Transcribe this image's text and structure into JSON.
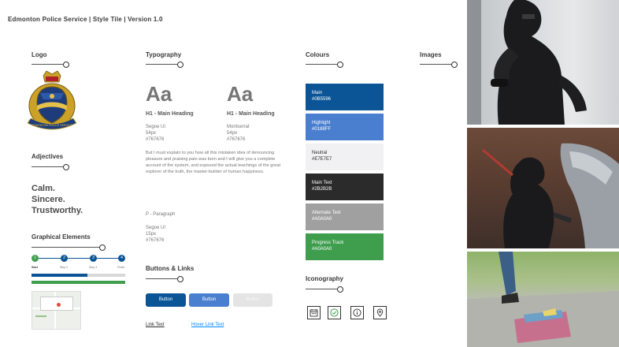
{
  "header": {
    "title": "Edmonton Police Service | Style Tile | Version 1.0"
  },
  "logo": {
    "heading": "Logo",
    "crest_text": "EDMONTON POLICE SERVICE"
  },
  "adjectives": {
    "heading": "Adjectives",
    "words": [
      "Calm.",
      "Sincere.",
      "Trustworthy."
    ]
  },
  "graphical": {
    "heading": "Graphical Elements",
    "steps": [
      "1",
      "2",
      "3",
      "4"
    ],
    "step_labels": [
      "Start",
      "Step 2",
      "Step 3",
      "Finish"
    ],
    "progress": 0.6,
    "progress_color": "#0B5596",
    "track_color": "#A0A0A0",
    "complete_color": "#3F9E4E"
  },
  "typography": {
    "heading": "Typography",
    "sample_glyph": "Aa",
    "fonts": [
      {
        "label": "H1 - Main Heading",
        "family": "Segoe UI",
        "size": "54px",
        "color": "#767676"
      },
      {
        "label": "H1 - Main Heading",
        "family": "Montserrat",
        "size": "54px",
        "color": "#767676"
      }
    ],
    "body_text": "But I must explain to you how all this mistaken idea of denouncing pleasure and praising pain was born and I will give you a complete account of the system, and expound the actual teachings of the great explorer of the truth, the master-builder of human happiness.",
    "paragraph": {
      "label": "P - Paragraph",
      "family": "Segoe UI",
      "size": "15px",
      "color": "#767676"
    }
  },
  "buttons": {
    "heading": "Buttons & Links",
    "labels": [
      "Button",
      "Button",
      "Button"
    ],
    "link_text": "Link Text",
    "hover_link_text": "Hover Link Text"
  },
  "colours": {
    "heading": "Colours",
    "swatches": [
      {
        "name": "Main",
        "hex": "#0B5596",
        "text_color": "#ffffff"
      },
      {
        "name": "Highlight",
        "hex": "#0188FF",
        "display": "#4A7FD0",
        "text_color": "#ffffff"
      },
      {
        "name": "Neutral",
        "hex": "#E7E7E7",
        "display": "#F1F1F4",
        "text_color": "#2B2B2B"
      },
      {
        "name": "Main Text",
        "hex": "#2B2B2B",
        "text_color": "#ffffff"
      },
      {
        "name": "Alternate Text",
        "hex": "#A0A0A0",
        "text_color": "#ffffff"
      },
      {
        "name": "Progress Track",
        "hex": "#A0A0A0",
        "display": "#3F9E4E",
        "text_color": "#ffffff"
      }
    ]
  },
  "iconography": {
    "heading": "Iconography",
    "icons": [
      "calendar-icon",
      "check-circle-icon",
      "info-icon",
      "map-pin-icon"
    ]
  },
  "images": {
    "heading": "Images"
  }
}
